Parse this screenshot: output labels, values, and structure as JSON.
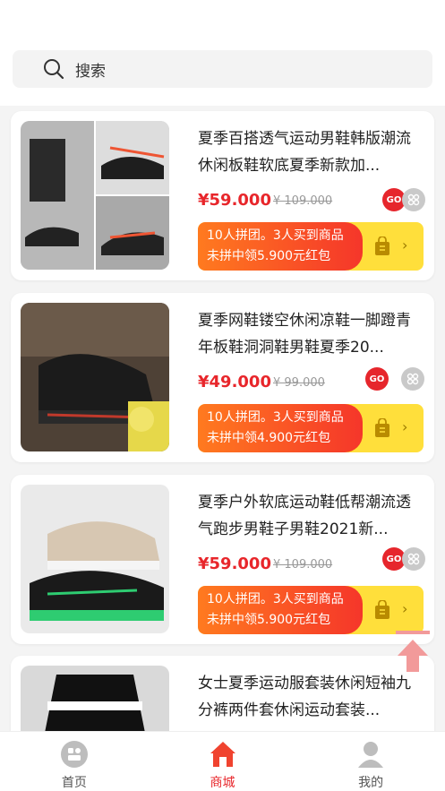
{
  "search": {
    "placeholder": "搜索"
  },
  "products": [
    {
      "title": "夏季百搭透气运动男鞋韩版潮流休闲板鞋软底夏季新款加...",
      "price": "¥59.000",
      "original_price": "¥ 109.000",
      "group_line1": "10人拼团。3人买到商品",
      "group_line2": "未拼中领5.900元红包"
    },
    {
      "title": "夏季网鞋镂空休闲凉鞋一脚蹬青年板鞋洞洞鞋男鞋夏季20...",
      "price": "¥49.000",
      "original_price": "¥ 99.000",
      "group_line1": "10人拼团。3人买到商品",
      "group_line2": "未拼中领4.900元红包"
    },
    {
      "title": "夏季户外软底运动鞋低帮潮流透气跑步男鞋子男鞋2021新...",
      "price": "¥59.000",
      "original_price": "¥ 109.000",
      "group_line1": "10人拼团。3人买到商品",
      "group_line2": "未拼中领5.900元红包"
    },
    {
      "title": "女士夏季运动服套装休闲短袖九分裤两件套休闲运动套装..."
    }
  ],
  "badges": {
    "go": "GO"
  },
  "tabs": [
    {
      "label": "首页",
      "icon": "home-icon",
      "active": false
    },
    {
      "label": "商城",
      "icon": "store-icon",
      "active": true
    },
    {
      "label": "我的",
      "icon": "user-icon",
      "active": false
    }
  ],
  "colors": {
    "accent": "#e8262b",
    "banner_yellow": "#ffdf3b",
    "banner_orange": "#ff7a1f"
  }
}
